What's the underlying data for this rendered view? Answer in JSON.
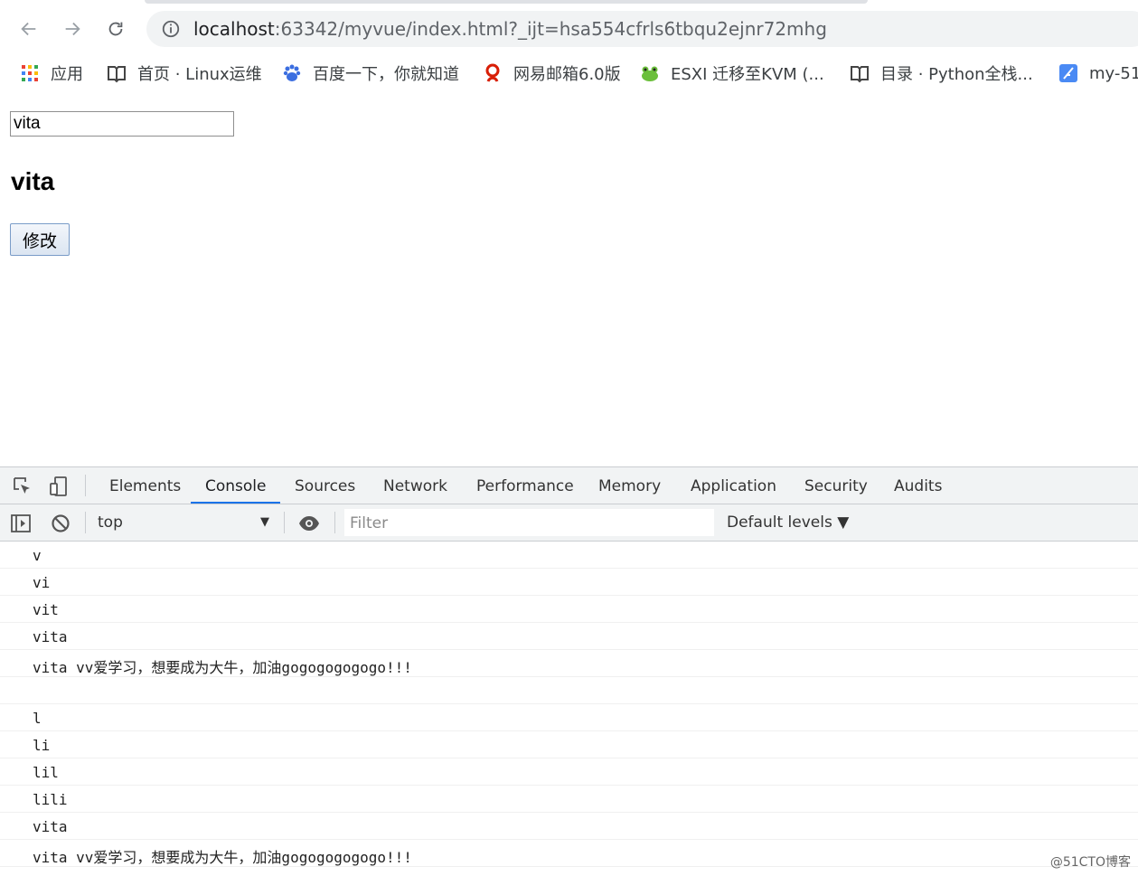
{
  "browser": {
    "url_host": "localhost",
    "url_rest": ":63342/myvue/index.html?_ijt=hsa554cfrls6tbqu2ejnr72mhg",
    "bookmarks": [
      {
        "label": "应用",
        "icon": "apps-grid-icon"
      },
      {
        "label": "首页 · Linux运维",
        "icon": "book-icon"
      },
      {
        "label": "百度一下，你就知道",
        "icon": "baidu-paw-icon"
      },
      {
        "label": "网易邮箱6.0版",
        "icon": "netease-icon"
      },
      {
        "label": "ESXI 迁移至KVM (...",
        "icon": "frog-icon"
      },
      {
        "label": "目录 · Python全栈...",
        "icon": "book-icon"
      },
      {
        "label": "my-51",
        "icon": "feather-icon"
      }
    ]
  },
  "page": {
    "input_value": "vita",
    "heading": "vita",
    "button_label": "修改"
  },
  "devtools": {
    "tabs": [
      "Elements",
      "Console",
      "Sources",
      "Network",
      "Performance",
      "Memory",
      "Application",
      "Security",
      "Audits"
    ],
    "active_tab": "Console",
    "context": "top",
    "filter_placeholder": "Filter",
    "levels": "Default levels ▼",
    "logs": [
      "v",
      "vi",
      "vit",
      "vita",
      "vita vv爱学习，想要成为大牛，加油gogogogogogo!!!",
      "",
      "l",
      "li",
      "lil",
      "lili",
      "vita",
      "vita vv爱学习，想要成为大牛，加油gogogogogogo!!!"
    ]
  },
  "watermark": "@51CTO博客",
  "colors": {
    "accent": "#1a73e8",
    "omnibox": "#f1f3f4"
  }
}
